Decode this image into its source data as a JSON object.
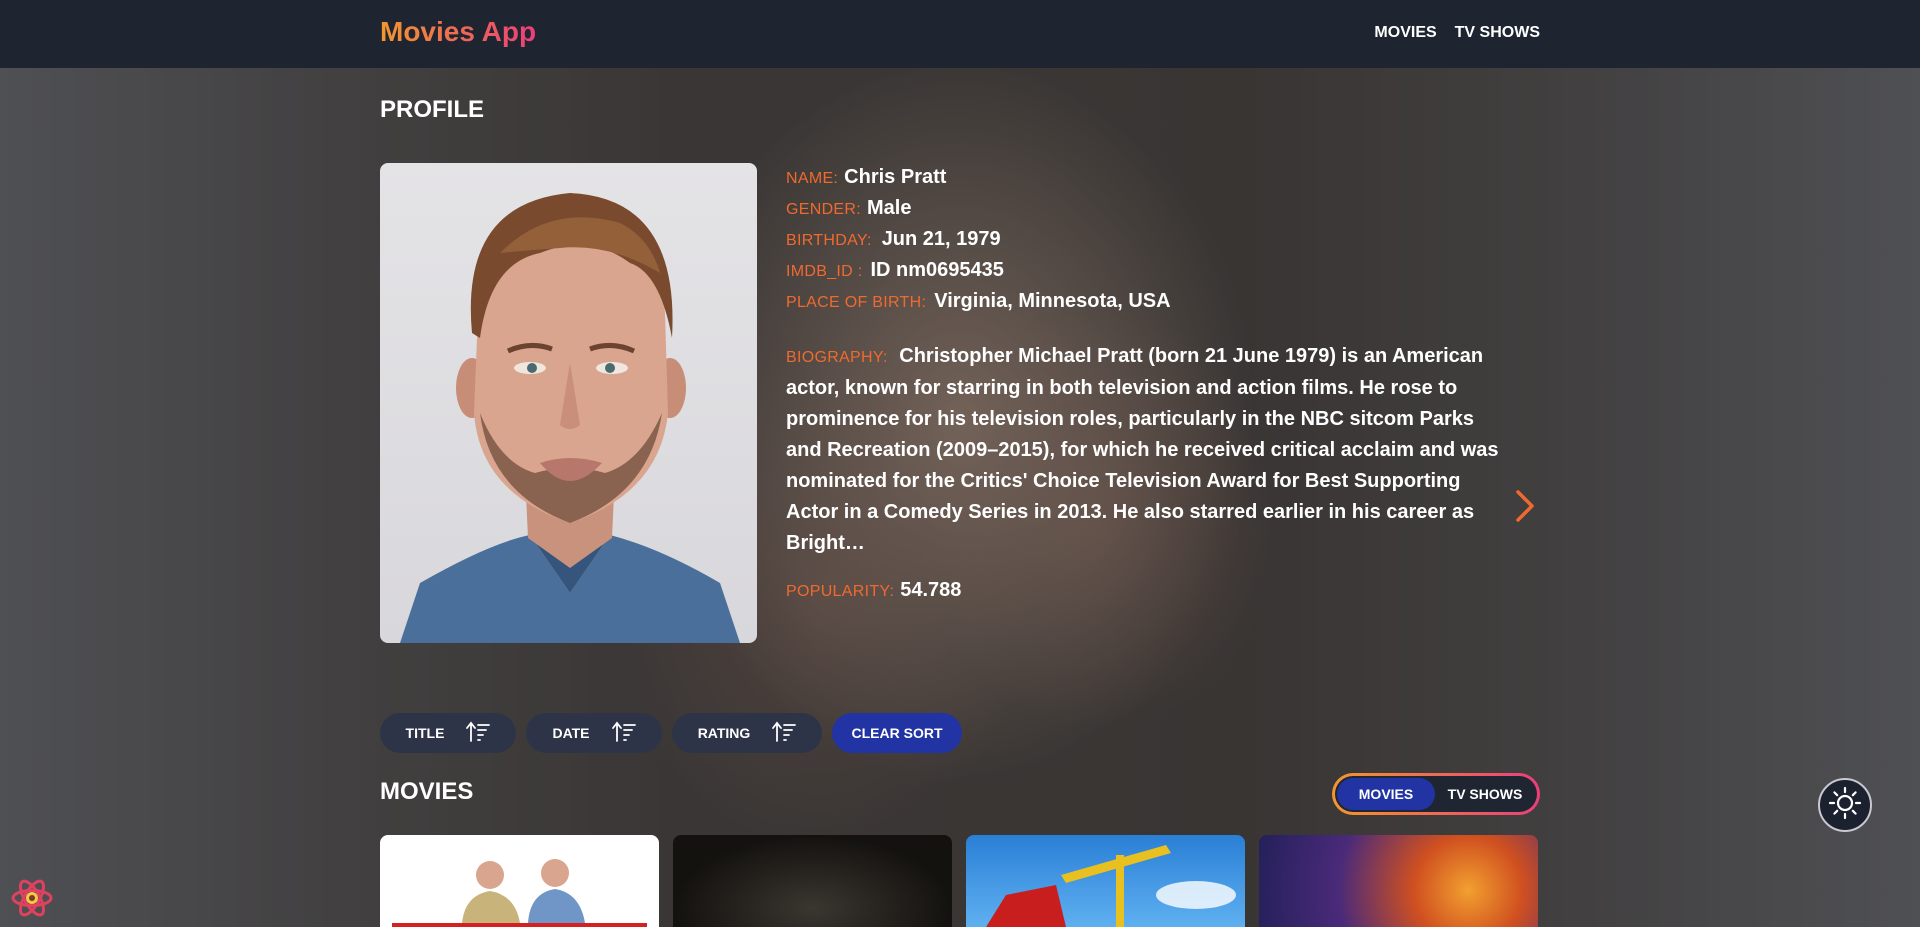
{
  "app": {
    "brand": "Movies App",
    "nav": [
      "MOVIES",
      "TV SHOWS"
    ]
  },
  "profile": {
    "heading": "PROFILE",
    "name_label": "NAME:",
    "name": "Chris Pratt",
    "gender_label": "GENDER:",
    "gender": "Male",
    "birthday_label": "BIRTHDAY:",
    "birthday": "Jun 21, 1979",
    "imdb_label": "IMDB_ID :",
    "imdb_id": "ID nm0695435",
    "place_label": "PLACE OF BIRTH:",
    "place_of_birth": "Virginia, Minnesota, USA",
    "bio_label": "BIOGRAPHY:",
    "biography": "Christopher Michael Pratt (born 21 June 1979) is an American actor, known for starring in both television and action films. He rose to prominence for his television roles, particularly in the NBC sitcom Parks and Recreation (2009–2015), for which he received critical acclaim and was nominated for the Critics' Choice Television Award for Best Supporting Actor in a Comedy Series in 2013. He also starred earlier in his career as Bright…",
    "popularity_label": "POPULARITY:",
    "popularity": "54.788"
  },
  "sort": {
    "title": "TITLE",
    "date": "DATE",
    "rating": "RATING",
    "clear": "CLEAR SORT"
  },
  "section": {
    "heading": "MOVIES",
    "toggle_active": "MOVIES",
    "toggle_other": "TV SHOWS"
  },
  "colors": {
    "accent_orange": "#ef6a2f",
    "button_blue": "#2233a3",
    "header_bg": "#1e2530"
  },
  "icons": [
    "sort-ascending-icon",
    "chevron-right-icon",
    "sun-icon",
    "react-logo-icon"
  ]
}
